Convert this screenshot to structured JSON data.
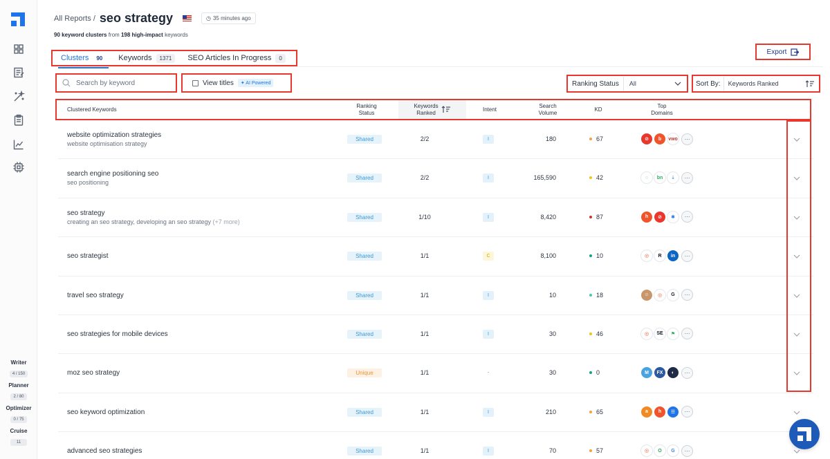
{
  "sidebar": {
    "nav": [
      {
        "icon": "dashboard-icon"
      },
      {
        "icon": "edit-document-icon"
      },
      {
        "icon": "magic-wand-icon"
      },
      {
        "icon": "clipboard-icon"
      },
      {
        "icon": "chart-line-icon"
      },
      {
        "icon": "chip-icon"
      }
    ],
    "usage": [
      {
        "label": "Writer",
        "value": "4 / 150"
      },
      {
        "label": "Planner",
        "value": "2 / 80"
      },
      {
        "label": "Optimizer",
        "value": "0 / 75"
      },
      {
        "label": "Cruise",
        "value": "11"
      }
    ]
  },
  "header": {
    "breadcrumb_root": "All Reports /",
    "title": "seo strategy",
    "updated": "35 minutes ago",
    "subtitle": {
      "clusters_count": "90 keyword clusters",
      "from_text": " from ",
      "impact_count": "198 high-impact",
      "suffix": " keywords"
    }
  },
  "tabs": [
    {
      "label": "Clusters",
      "count": "90"
    },
    {
      "label": "Keywords",
      "count": "1371"
    },
    {
      "label": "SEO Articles In Progress",
      "count": "0"
    }
  ],
  "export_label": "Export",
  "filters": {
    "search_placeholder": "Search by keyword",
    "view_titles_label": "View titles",
    "ai_badge": "AI Powered",
    "ranking_label": "Ranking Status",
    "ranking_value": "All",
    "sort_label": "Sort By:",
    "sort_value": "Keywords Ranked"
  },
  "table": {
    "columns": {
      "keywords": "Clustered Keywords",
      "status": [
        "Ranking",
        "Status"
      ],
      "ranked": [
        "Keywords",
        "Ranked"
      ],
      "intent": "Intent",
      "volume": [
        "Search",
        "Volume"
      ],
      "kd": "KD",
      "domains": [
        "Top",
        "Domains"
      ]
    },
    "rows": [
      {
        "primary": "website optimization strategies",
        "secondary": "website optimisation strategy",
        "more": "",
        "status": "Shared",
        "ranked": "2/2",
        "intent": "I",
        "volume": "180",
        "kd": "67",
        "kd_color": "#f59e42",
        "domains": [
          {
            "bg": "#e8372c",
            "t": "⊘"
          },
          {
            "bg": "#f0542c",
            "t": "b"
          },
          {
            "bg": "#ffffff",
            "t": "vwo",
            "fg": "#c0392b"
          }
        ]
      },
      {
        "primary": "search engine positioning seo",
        "secondary": "seo positioning",
        "more": "",
        "status": "Shared",
        "ranked": "2/2",
        "intent": "I",
        "volume": "165,590",
        "kd": "42",
        "kd_color": "#f0c419",
        "domains": [
          {
            "bg": "#ffffff",
            "t": "◌",
            "fg": "#27ae60"
          },
          {
            "bg": "#ffffff",
            "t": "bn",
            "fg": "#27ae60"
          },
          {
            "bg": "#ffffff",
            "t": "⇣",
            "fg": "#3b98d6"
          }
        ]
      },
      {
        "primary": "seo strategy",
        "secondary": "creating an seo strategy, developing an seo strategy",
        "more": "(+7 more)",
        "status": "Shared",
        "ranked": "1/10",
        "intent": "I",
        "volume": "8,420",
        "kd": "87",
        "kd_color": "#c0392b",
        "domains": [
          {
            "bg": "#f0542c",
            "t": "h"
          },
          {
            "bg": "#e8372c",
            "t": "⊘"
          },
          {
            "bg": "#ffffff",
            "t": "✱",
            "fg": "#1e74e8"
          }
        ]
      },
      {
        "primary": "seo strategist",
        "secondary": "",
        "more": "",
        "status": "Shared",
        "ranked": "1/1",
        "intent": "C",
        "volume": "8,100",
        "kd": "10",
        "kd_color": "#16a085",
        "domains": [
          {
            "bg": "#ffffff",
            "t": "◎",
            "fg": "#f0542c"
          },
          {
            "bg": "#ffffff",
            "t": "R",
            "fg": "#111827"
          },
          {
            "bg": "#0a66c2",
            "t": "in"
          }
        ]
      },
      {
        "primary": "travel seo strategy",
        "secondary": "",
        "more": "",
        "status": "Shared",
        "ranked": "1/1",
        "intent": "I",
        "volume": "10",
        "kd": "18",
        "kd_color": "#48c9b0",
        "domains": [
          {
            "bg": "#c9956a",
            "t": "☺"
          },
          {
            "bg": "#ffffff",
            "t": "◎",
            "fg": "#f0542c"
          },
          {
            "bg": "#ffffff",
            "t": "G",
            "fg": "#111827"
          }
        ]
      },
      {
        "primary": "seo strategies for mobile devices",
        "secondary": "",
        "more": "",
        "status": "Shared",
        "ranked": "1/1",
        "intent": "I",
        "volume": "30",
        "kd": "46",
        "kd_color": "#f0c419",
        "domains": [
          {
            "bg": "#ffffff",
            "t": "◎",
            "fg": "#f0542c"
          },
          {
            "bg": "#ffffff",
            "t": "SE",
            "fg": "#111827"
          },
          {
            "bg": "#ffffff",
            "t": "⚑",
            "fg": "#27ae60"
          }
        ]
      },
      {
        "primary": "moz seo strategy",
        "secondary": "",
        "more": "",
        "status": "Unique",
        "ranked": "1/1",
        "intent": "-",
        "volume": "30",
        "kd": "0",
        "kd_color": "#16a085",
        "domains": [
          {
            "bg": "#4aa3df",
            "t": "M"
          },
          {
            "bg": "#2c5aa0",
            "t": "FX"
          },
          {
            "bg": "#1f2a44",
            "t": "◐"
          }
        ]
      },
      {
        "primary": "seo keyword optimization",
        "secondary": "",
        "more": "",
        "status": "Shared",
        "ranked": "1/1",
        "intent": "I",
        "volume": "210",
        "kd": "65",
        "kd_color": "#f59e42",
        "domains": [
          {
            "bg": "#f08a24",
            "t": "a"
          },
          {
            "bg": "#f0542c",
            "t": "h"
          },
          {
            "bg": "#1e74e8",
            "t": "☰"
          }
        ]
      },
      {
        "primary": "advanced seo strategies",
        "secondary": "",
        "more": "",
        "status": "Shared",
        "ranked": "1/1",
        "intent": "I",
        "volume": "70",
        "kd": "57",
        "kd_color": "#f59e42",
        "domains": [
          {
            "bg": "#ffffff",
            "t": "◎",
            "fg": "#f0542c"
          },
          {
            "bg": "#ffffff",
            "t": "O",
            "fg": "#27ae60"
          },
          {
            "bg": "#ffffff",
            "t": "G",
            "fg": "#4285f4"
          }
        ]
      }
    ]
  }
}
